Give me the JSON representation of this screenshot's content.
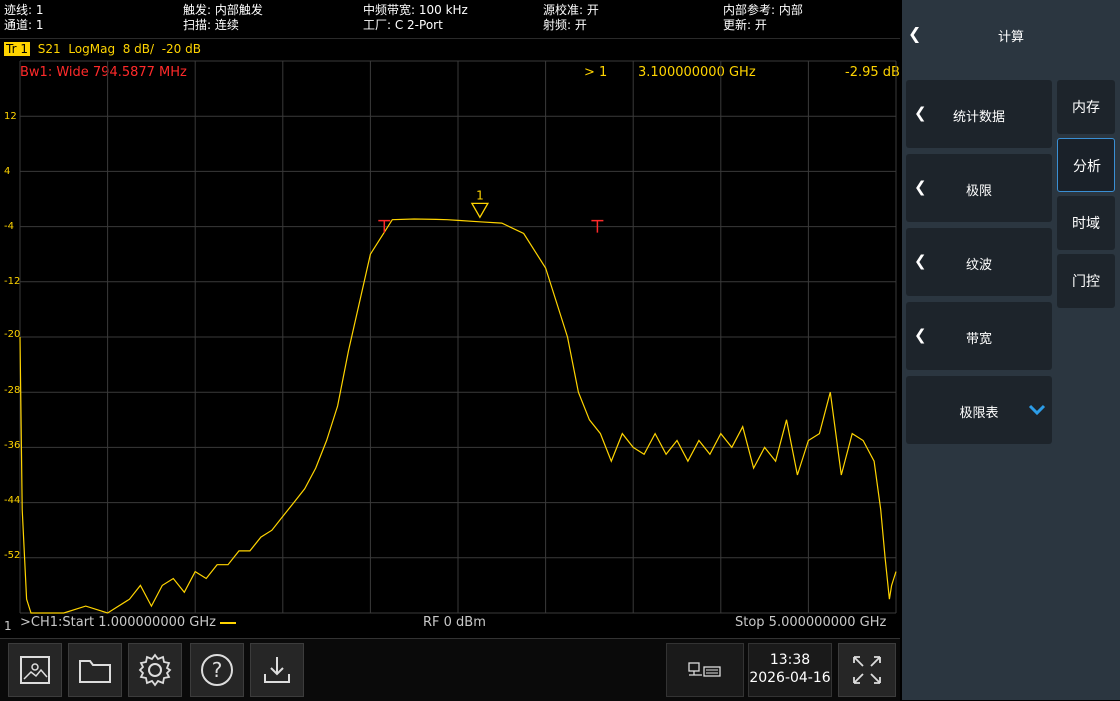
{
  "status": {
    "trace": "迹线: 1",
    "channel": "通道: 1",
    "trigger": "触发: 内部触发",
    "sweep": "扫描: 连续",
    "if_bw": "中频带宽: 100 kHz",
    "cal": "工厂: C 2-Port",
    "source_cal": "源校准: 开",
    "rf": "射频: 开",
    "ref": "内部参考: 内部",
    "update": "更新: 开"
  },
  "trace_bar": {
    "badge": "Tr 1",
    "param": "S21",
    "format": "LogMag",
    "scale": "8 dB/",
    "ref": "-20 dB"
  },
  "bandwidth_readout": "Bw1: Wide 794.5877 MHz",
  "marker": {
    "id": "> 1",
    "freq": "3.100000000 GHz",
    "value": "-2.95 dB",
    "label": "1"
  },
  "bottom_info": {
    "start": ">CH1:Start 1.000000000 GHz",
    "power": "RF 0 dBm",
    "stop": "Stop 5.000000000 GHz",
    "channel_index": "1"
  },
  "chart_data": {
    "type": "line",
    "xlabel": "",
    "ylabel": "",
    "xlim": [
      1.0,
      5.0
    ],
    "ylim": [
      -60,
      20
    ],
    "y_ticks": [
      12,
      4,
      -4,
      -12,
      -20,
      -28,
      -36,
      -44,
      -52
    ],
    "grid": true,
    "series": [
      {
        "color": "#ffd400",
        "x": [
          1.0,
          1.01,
          1.03,
          1.05,
          1.1,
          1.2,
          1.3,
          1.4,
          1.5,
          1.55,
          1.6,
          1.65,
          1.7,
          1.75,
          1.8,
          1.85,
          1.9,
          1.95,
          2.0,
          2.05,
          2.1,
          2.15,
          2.2,
          2.25,
          2.3,
          2.35,
          2.4,
          2.45,
          2.5,
          2.6,
          2.7,
          2.8,
          2.9,
          2.95,
          3.0,
          3.1,
          3.2,
          3.3,
          3.4,
          3.5,
          3.55,
          3.6,
          3.65,
          3.7,
          3.75,
          3.8,
          3.85,
          3.9,
          3.95,
          4.0,
          4.05,
          4.1,
          4.15,
          4.2,
          4.25,
          4.3,
          4.35,
          4.4,
          4.45,
          4.5,
          4.55,
          4.6,
          4.65,
          4.7,
          4.75,
          4.8,
          4.85,
          4.9,
          4.93,
          4.95,
          4.97,
          4.98,
          4.99,
          5.0
        ],
        "y": [
          -20,
          -45,
          -58,
          -60,
          -60,
          -60,
          -59,
          -60,
          -58,
          -56,
          -59,
          -56,
          -55,
          -57,
          -54,
          -55,
          -53,
          -53,
          -51,
          -51,
          -49,
          -48,
          -46,
          -44,
          -42,
          -39,
          -35,
          -30,
          -22,
          -8,
          -3,
          -2.9,
          -2.95,
          -3.0,
          -3.1,
          -3.3,
          -3.5,
          -5,
          -10,
          -20,
          -28,
          -32,
          -34,
          -38,
          -34,
          -36,
          -37,
          -34,
          -37,
          -35,
          -38,
          -35,
          -37,
          -34,
          -36,
          -33,
          -39,
          -36,
          -38,
          -32,
          -40,
          -35,
          -34,
          -28,
          -40,
          -34,
          -35,
          -38,
          -45,
          -52,
          -58,
          -56,
          -55,
          -54
        ]
      }
    ]
  },
  "toolbar": {
    "time": "13:38",
    "date": "2026-04-16"
  },
  "panel": {
    "title": "计算",
    "menu": [
      {
        "label": "统计数据"
      },
      {
        "label": "极限"
      },
      {
        "label": "纹波"
      },
      {
        "label": "带宽"
      },
      {
        "label": "极限表"
      }
    ],
    "tabs": [
      {
        "label": "内存"
      },
      {
        "label": "分析"
      },
      {
        "label": "时域"
      },
      {
        "label": "门控"
      }
    ]
  }
}
